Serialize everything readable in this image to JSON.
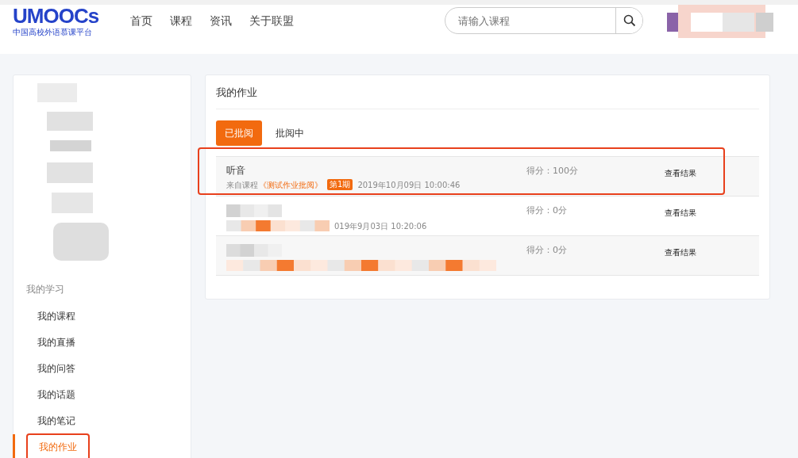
{
  "header": {
    "logo_text": "UMOOCs",
    "logo_subtitle": "中国高校外语慕课平台",
    "nav": [
      {
        "label": "首页",
        "selected": false
      },
      {
        "label": "课程",
        "selected": false
      },
      {
        "label": "资讯",
        "selected": false
      },
      {
        "label": "关于联盟",
        "selected": false
      }
    ],
    "search": {
      "placeholder": "请输入课程"
    }
  },
  "sidebar": {
    "section_title": "我的学习",
    "items": [
      {
        "label": "我的课程",
        "selected": false,
        "annotated": false
      },
      {
        "label": "我的直播",
        "selected": false,
        "annotated": false
      },
      {
        "label": "我的问答",
        "selected": false,
        "annotated": false
      },
      {
        "label": "我的话题",
        "selected": false,
        "annotated": false
      },
      {
        "label": "我的笔记",
        "selected": false,
        "annotated": false
      },
      {
        "label": "我的作业",
        "selected": true,
        "annotated": true
      }
    ]
  },
  "main": {
    "title": "我的作业",
    "tabs": [
      {
        "label": "已批阅",
        "selected": true
      },
      {
        "label": "批阅中",
        "selected": false
      }
    ],
    "rows": [
      {
        "title": "听音",
        "source_prefix": "来自课程",
        "course": "《测试作业批阅》",
        "badge": "第1期",
        "date": "2019年10月09日 10:00:46",
        "score": "得分：100分",
        "action": "查看结果",
        "annotated": true
      },
      {
        "date": "019年9月03日 10:20:06",
        "score": "得分：0分",
        "action": "查看结果",
        "annotated": false
      },
      {
        "score": "得分：0分",
        "action": "查看结果",
        "annotated": false
      }
    ]
  }
}
